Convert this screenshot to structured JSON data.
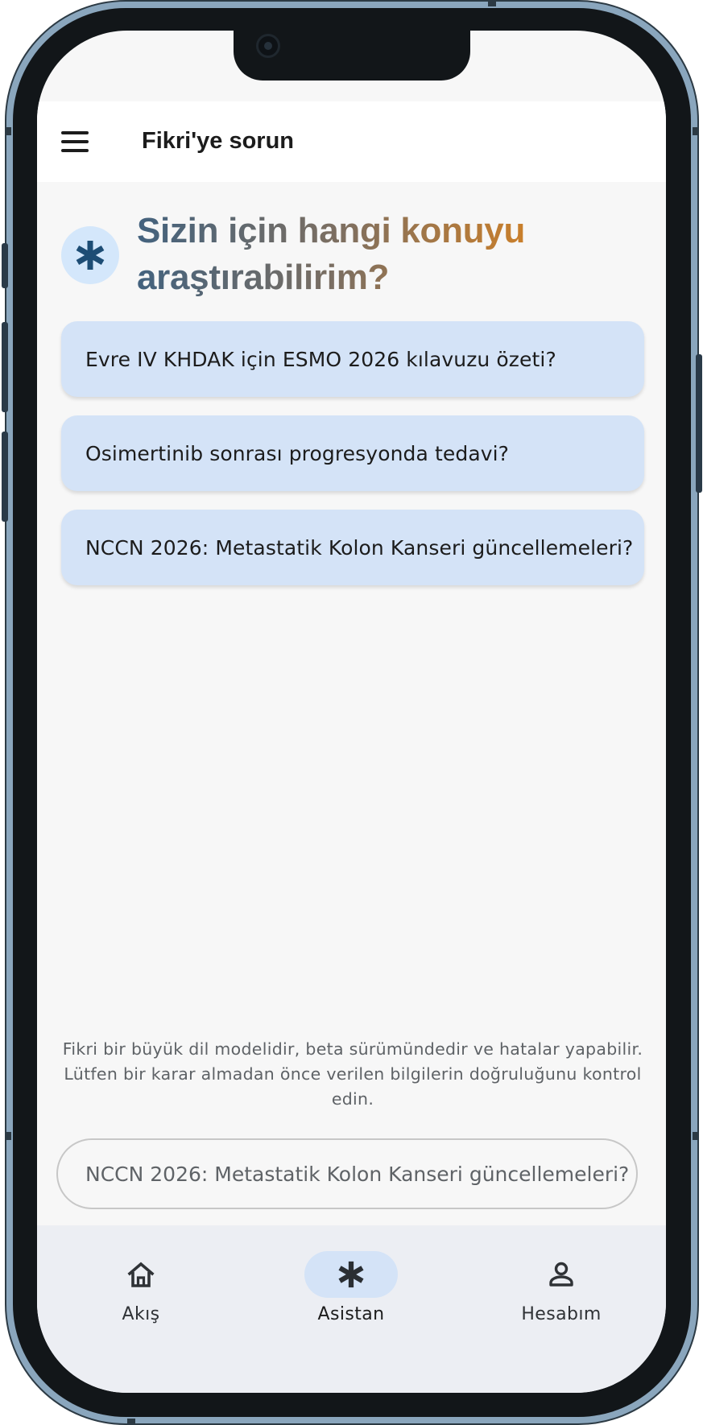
{
  "app_bar": {
    "title": "Fikri'ye sorun",
    "menu_icon": "hamburger-menu-icon"
  },
  "hero": {
    "icon": "asterisk-icon",
    "title": "Sizin için hangi konuyu araştırabilirim?",
    "gradient_colors": [
      "#43627e",
      "#d98426"
    ]
  },
  "suggestions": [
    {
      "label": "Evre IV KHDAK için ESMO 2026 kılavuzu özeti?"
    },
    {
      "label": "Osimertinib sonrası progresyonda tedavi?"
    },
    {
      "label": "NCCN 2026: Metastatik Kolon Kanseri güncellemeleri?"
    }
  ],
  "disclaimer": "Fikri bir büyük dil modelidir, beta sürümündedir ve hatalar yapabilir. Lütfen bir karar almadan önce verilen bilgilerin doğruluğunu kontrol edin.",
  "input": {
    "placeholder": "NCCN 2026: Metastatik Kolon Kanseri güncellemeleri?"
  },
  "bottom_nav": {
    "items": [
      {
        "label": "Akış",
        "icon": "home-icon",
        "active": false
      },
      {
        "label": "Asistan",
        "icon": "asterisk-icon",
        "active": true
      },
      {
        "label": "Hesabım",
        "icon": "person-icon",
        "active": false
      }
    ]
  },
  "colors": {
    "accent": "#d4e3f7",
    "hero_icon_bg": "#d4e7fb",
    "asterisk": "#1d4d75"
  }
}
